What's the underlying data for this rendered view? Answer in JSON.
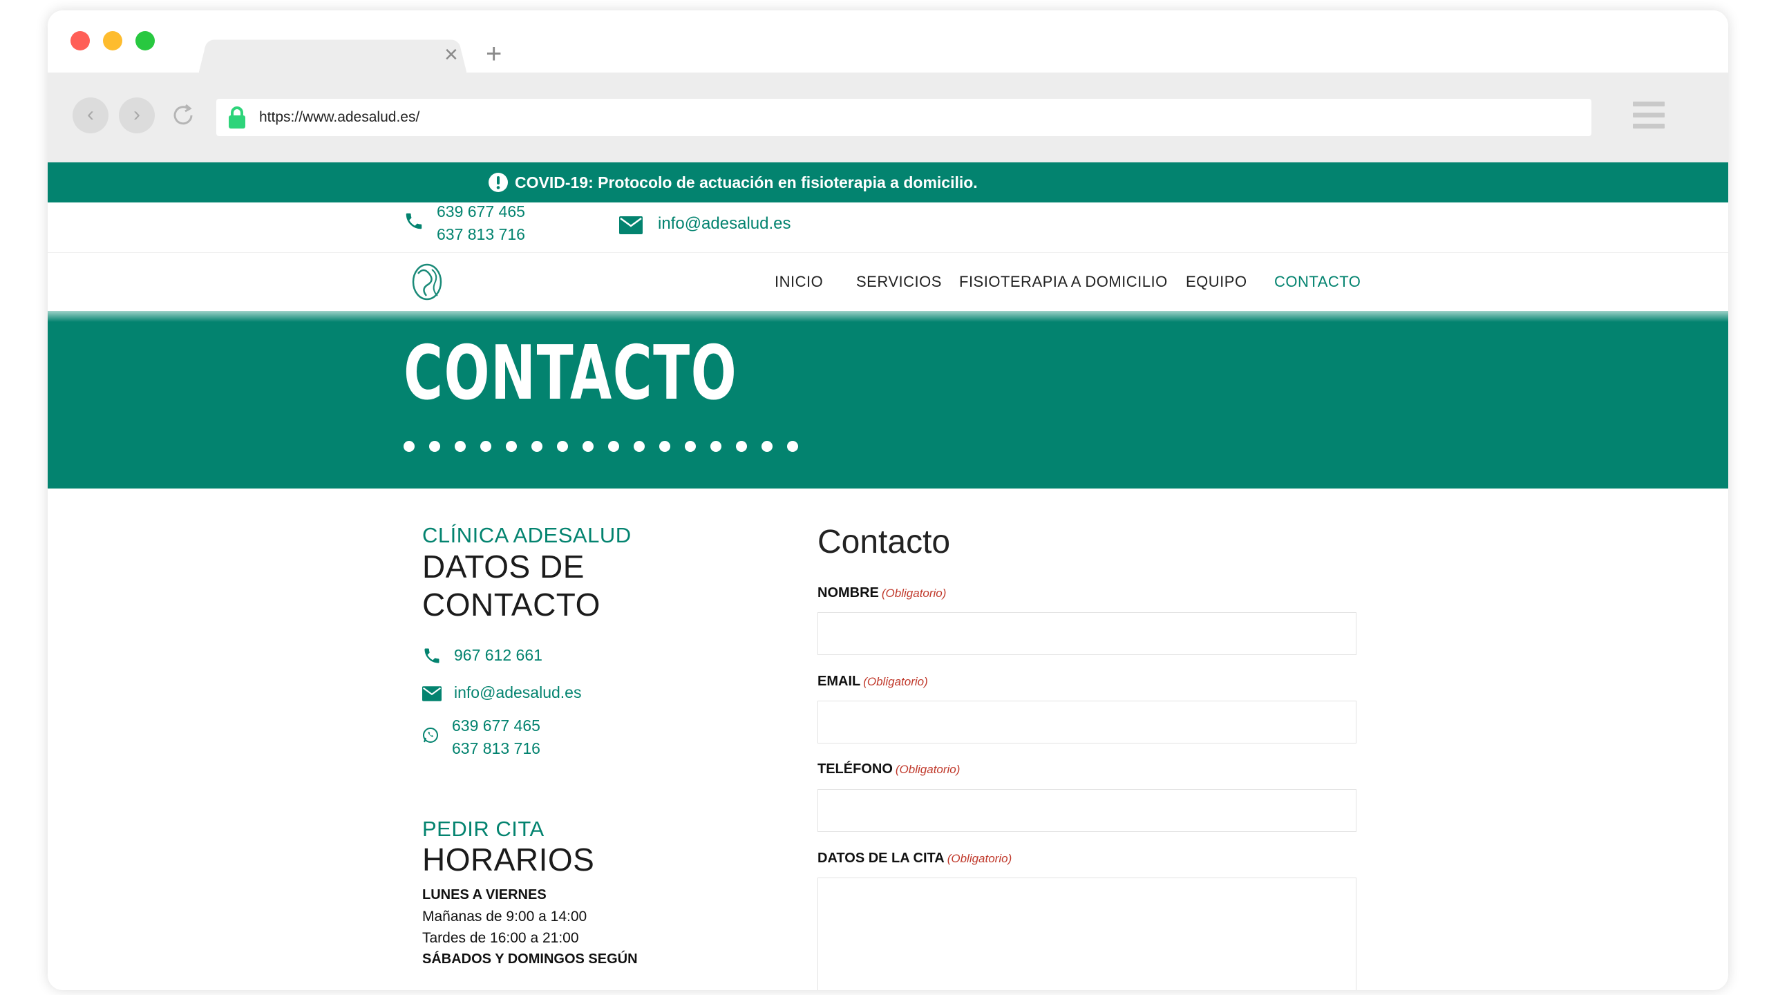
{
  "browser": {
    "url": "https://www.adesalud.es/",
    "tab_close": "×",
    "tab_new": "+",
    "back_glyph": "‹",
    "forward_glyph": "›"
  },
  "banner": {
    "text": "COVID-19: Protocolo de actuación en fisioterapia a domicilio.",
    "icon": "exclamation-circle-icon"
  },
  "topbar": {
    "phone_1": "639 677 465",
    "phone_2": "637 813 716",
    "email": "info@adesalud.es"
  },
  "nav": {
    "items": [
      {
        "label": "INICIO",
        "active": false
      },
      {
        "label": "SERVICIOS",
        "active": false
      },
      {
        "label": "FISIOTERAPIA A DOMICILIO",
        "active": false
      },
      {
        "label": "EQUIPO",
        "active": false
      },
      {
        "label": "CONTACTO",
        "active": true
      }
    ]
  },
  "hero": {
    "title": "CONTACTO"
  },
  "contact_info": {
    "kicker": "CLÍNICA ADESALUD",
    "title_line1": "DATOS DE",
    "title_line2": "CONTACTO",
    "phone": "967 612 661",
    "email": "info@adesalud.es",
    "whatsapp_1": "639 677 465",
    "whatsapp_2": "637 813 716"
  },
  "hours": {
    "kicker": "PEDIR CITA",
    "title": "HORARIOS",
    "weekdays_label": "LUNES A VIERNES",
    "mornings": "Mañanas de 9:00 a 14:00",
    "afternoons": "Tardes de 16:00 a 21:00",
    "weekend_label": "SÁBADOS Y DOMINGOS SEGÚN"
  },
  "form": {
    "title": "Contacto",
    "required": "(Obligatorio)",
    "fields": [
      {
        "label": "NOMBRE",
        "value": ""
      },
      {
        "label": "EMAIL",
        "value": ""
      },
      {
        "label": "TELÉFONO",
        "value": ""
      },
      {
        "label": "DATOS DE LA CITA",
        "value": ""
      }
    ]
  },
  "colors": {
    "brand": "#03836f",
    "required": "#c0392b"
  }
}
